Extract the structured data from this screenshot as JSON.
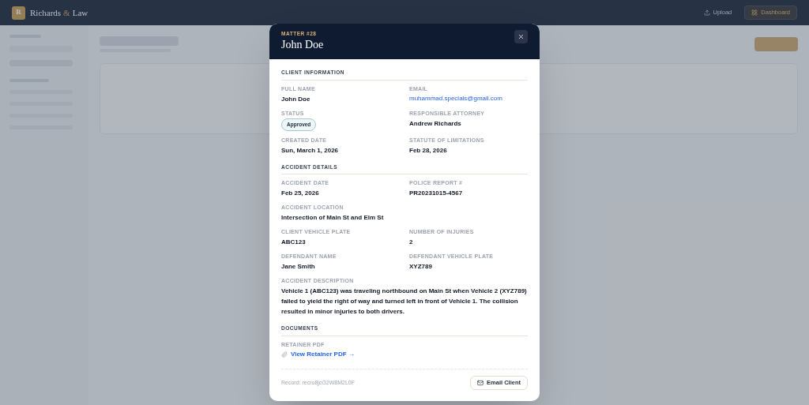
{
  "header": {
    "logo_letter": "R",
    "brand_first": "Richards",
    "brand_amp": "&",
    "brand_last": "Law",
    "buttons": [
      {
        "label": "Upload",
        "kind": "ghost"
      },
      {
        "label": "Dashboard",
        "kind": "outlined"
      }
    ]
  },
  "modal": {
    "eyebrow": "MATTER #28",
    "title": "John Doe",
    "sections": [
      {
        "title": "CLIENT INFORMATION",
        "fields": [
          {
            "label": "FULL NAME",
            "value": "John Doe",
            "kind": "text"
          },
          {
            "label": "EMAIL",
            "value": "muhammad.specials@gmail.com",
            "kind": "link"
          },
          {
            "label": "STATUS",
            "value": "Approved",
            "kind": "badge"
          },
          {
            "label": "RESPONSIBLE ATTORNEY",
            "value": "Andrew Richards",
            "kind": "text"
          },
          {
            "label": "CREATED DATE",
            "value": "Sun, March 1, 2026",
            "kind": "text"
          },
          {
            "label": "STATUTE OF LIMITATIONS",
            "value": "Feb 28, 2026",
            "kind": "text"
          }
        ]
      },
      {
        "title": "ACCIDENT DETAILS",
        "fields": [
          {
            "label": "ACCIDENT DATE",
            "value": "Feb 25, 2026",
            "kind": "text"
          },
          {
            "label": "POLICE REPORT #",
            "value": "PR20231015-4567",
            "kind": "text"
          },
          {
            "label": "ACCIDENT LOCATION",
            "value": "Intersection of Main St and Elm St",
            "kind": "wide"
          },
          {
            "label": "CLIENT VEHICLE PLATE",
            "value": "ABC123",
            "kind": "text"
          },
          {
            "label": "NUMBER OF INJURIES",
            "value": "2",
            "kind": "text"
          },
          {
            "label": "DEFENDANT NAME",
            "value": "Jane Smith",
            "kind": "text"
          },
          {
            "label": "DEFENDANT VEHICLE PLATE",
            "value": "XYZ789",
            "kind": "text"
          },
          {
            "label": "ACCIDENT DESCRIPTION",
            "value": "Vehicle 1 (ABC123) was traveling northbound on Main St when Vehicle 2 (XYZ789) failed to yield the right of way and turned left in front of Vehicle 1. The collision resulted in minor injuries to both drivers.",
            "kind": "wide"
          }
        ]
      },
      {
        "title": "DOCUMENTS",
        "fields": [
          {
            "label": "RETAINER PDF",
            "value": "View Retainer PDF →",
            "kind": "file"
          }
        ]
      }
    ],
    "record": "Record: recro8jcO2W8M2L0F",
    "footer_button": "Email Client"
  }
}
